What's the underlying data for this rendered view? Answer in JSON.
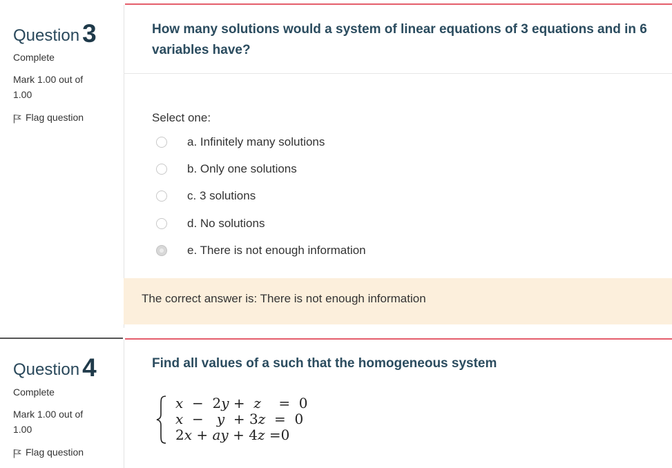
{
  "q3": {
    "label": "Question",
    "number": "3",
    "state": "Complete",
    "grade": "Mark 1.00 out of 1.00",
    "flag": "Flag question",
    "text": "How many solutions would a system of linear equations of 3 equations and in 6 variables have?",
    "prompt": "Select one:",
    "options": [
      {
        "label": "a. Infinitely many solutions",
        "selected": false
      },
      {
        "label": "b. Only one solutions",
        "selected": false
      },
      {
        "label": "c. 3 solutions",
        "selected": false
      },
      {
        "label": "d. No solutions",
        "selected": false
      },
      {
        "label": "e. There is not enough information",
        "selected": true
      }
    ],
    "feedback": "The correct answer is: There is not enough information"
  },
  "q4": {
    "label": "Question",
    "number": "4",
    "state": "Complete",
    "grade": "Mark 1.00 out of 1.00",
    "flag": "Flag question",
    "text": "Find all values of a such that the homogeneous system",
    "equations": [
      "x − 2y + z = 0",
      "x − y + 3z = 0",
      "2x + ay + 4z = 0"
    ]
  },
  "colors": {
    "accent_red": "#e45d6b",
    "question_text": "#2b4c5f",
    "feedback_bg": "#fcefdc"
  },
  "icons": {
    "flag": "flag-icon",
    "radio": "radio-icon",
    "brace": "left-brace-icon"
  }
}
